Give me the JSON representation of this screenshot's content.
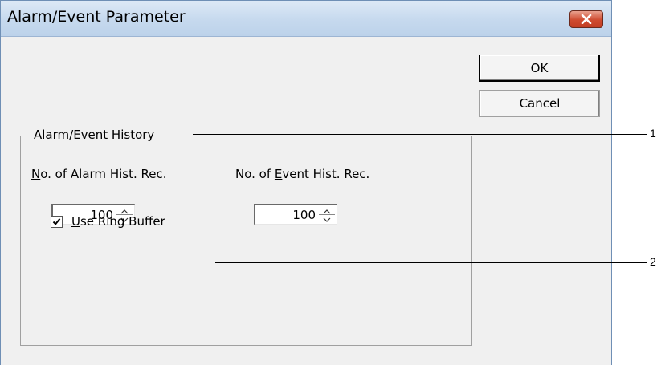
{
  "window": {
    "title": "Alarm/Event Parameter"
  },
  "buttons": {
    "ok": "OK",
    "cancel": "Cancel"
  },
  "group": {
    "label": "Alarm/Event History",
    "alarm_label_mnemonic": "N",
    "alarm_label_rest": "o. of Alarm Hist. Rec.",
    "event_label_prefix": "No. of ",
    "event_label_mnemonic": "E",
    "event_label_rest": "vent Hist. Rec.",
    "alarm_value": "100",
    "event_value": "100",
    "ring_buffer_checked": true,
    "ring_buffer_mnemonic": "U",
    "ring_buffer_rest": "se Ring Buffer"
  },
  "callouts": [
    "1",
    "2"
  ],
  "icons": {
    "close": "close-x-icon",
    "spin": "spin-arrows-icon",
    "check": "checkmark-icon"
  }
}
